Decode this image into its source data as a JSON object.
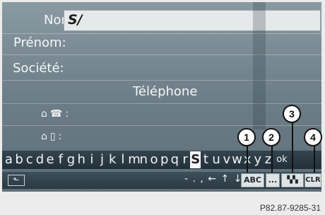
{
  "form": {
    "name_label": "Nom:",
    "name_value": "S/",
    "first_name_label": "Prénom:",
    "company_label": "Société:",
    "phone_header": "Téléphone",
    "phone_home_suffix": ":",
    "phone_mobile_suffix": ":"
  },
  "keyboard": {
    "letters": [
      "a",
      "b",
      "c",
      "d",
      "e",
      "f",
      "g",
      "h",
      "i",
      "j",
      "k",
      "l",
      "m",
      "n",
      "o",
      "p",
      "q",
      "r",
      "S",
      "t",
      "u",
      "v",
      "w",
      "x",
      "y",
      "z",
      "ok"
    ],
    "selected_letter": "S",
    "symbols": "- . , ← ↑ ↓ →",
    "abc_label": "ABC",
    "more_label": "...",
    "clr_label": "CLR"
  },
  "callouts": [
    "1",
    "2",
    "3",
    "4"
  ],
  "reference_code": "P82.87-9285-31"
}
